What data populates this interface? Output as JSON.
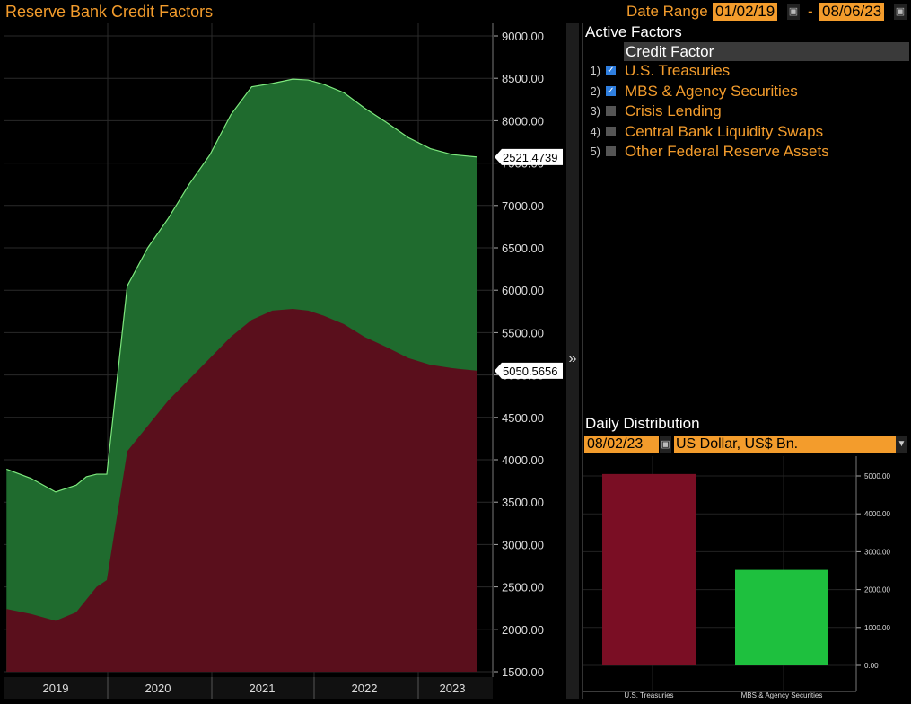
{
  "title": "Reserve Bank Credit Factors",
  "date_range": {
    "label": "Date Range",
    "start": "01/02/19",
    "separator": "-",
    "end": "08/06/23"
  },
  "colors": {
    "accent": "#f39c2c",
    "treasuries": "#5a0f1c",
    "mbs": "#1f6b2e",
    "mbs_line": "#7ee87e",
    "bar_treasuries": "#7a0e24",
    "bar_mbs": "#1ec03e"
  },
  "splitter_icon": "»",
  "active_factors": {
    "title": "Active Factors",
    "column_header": "Credit Factor",
    "items": [
      {
        "num": "1)",
        "checked": true,
        "label": "U.S. Treasuries"
      },
      {
        "num": "2)",
        "checked": true,
        "label": "MBS & Agency Securities"
      },
      {
        "num": "3)",
        "checked": false,
        "label": "Crisis Lending"
      },
      {
        "num": "4)",
        "checked": false,
        "label": "Central Bank Liquidity Swaps"
      },
      {
        "num": "5)",
        "checked": false,
        "label": "Other Federal Reserve Assets"
      }
    ]
  },
  "daily_distribution": {
    "title": "Daily Distribution",
    "date": "08/02/23",
    "currency": "US Dollar, US$ Bn."
  },
  "chart_data": [
    {
      "type": "area",
      "stacked": true,
      "x_labels": [
        "2019",
        "2020",
        "2021",
        "2022",
        "2023"
      ],
      "y_ticks": [
        "9000.00",
        "8500.00",
        "8000.00",
        "7500.00",
        "7000.00",
        "6500.00",
        "6000.00",
        "5500.00",
        "5000.00",
        "4500.00",
        "4000.00",
        "3500.00",
        "3000.00",
        "2500.00",
        "2000.00",
        "1500.00"
      ],
      "ylim": [
        1500,
        9000
      ],
      "x": [
        2019.0,
        2019.25,
        2019.5,
        2019.7,
        2019.8,
        2019.9,
        2020.0,
        2020.2,
        2020.4,
        2020.6,
        2020.8,
        2021.0,
        2021.2,
        2021.4,
        2021.6,
        2021.8,
        2021.95,
        2022.1,
        2022.3,
        2022.5,
        2022.7,
        2022.9,
        2023.1,
        2023.3,
        2023.45
      ],
      "series": [
        {
          "name": "U.S. Treasuries",
          "values": [
            2240,
            2180,
            2100,
            2200,
            2350,
            2500,
            2580,
            4100,
            4400,
            4700,
            4950,
            5200,
            5450,
            5650,
            5760,
            5780,
            5760,
            5700,
            5600,
            5450,
            5330,
            5200,
            5120,
            5080,
            5050
          ]
        },
        {
          "name": "MBS & Agency Securities",
          "values": [
            1650,
            1600,
            1520,
            1500,
            1450,
            1330,
            1250,
            1950,
            2100,
            2150,
            2300,
            2400,
            2620,
            2750,
            2680,
            2710,
            2720,
            2730,
            2730,
            2700,
            2650,
            2600,
            2550,
            2520,
            2521
          ]
        }
      ],
      "markers": [
        {
          "label": "2521.4739",
          "value": 7571
        },
        {
          "label": "5050.5656",
          "value": 5050
        }
      ]
    },
    {
      "type": "bar",
      "categories": [
        "U.S. Treasuries",
        "MBS & Agency Securities"
      ],
      "values": [
        5050.57,
        2521.47
      ],
      "y_ticks": [
        "5000.00",
        "4000.00",
        "3000.00",
        "2000.00",
        "1000.00",
        "0.00"
      ],
      "ylim": [
        0,
        5500
      ]
    }
  ]
}
